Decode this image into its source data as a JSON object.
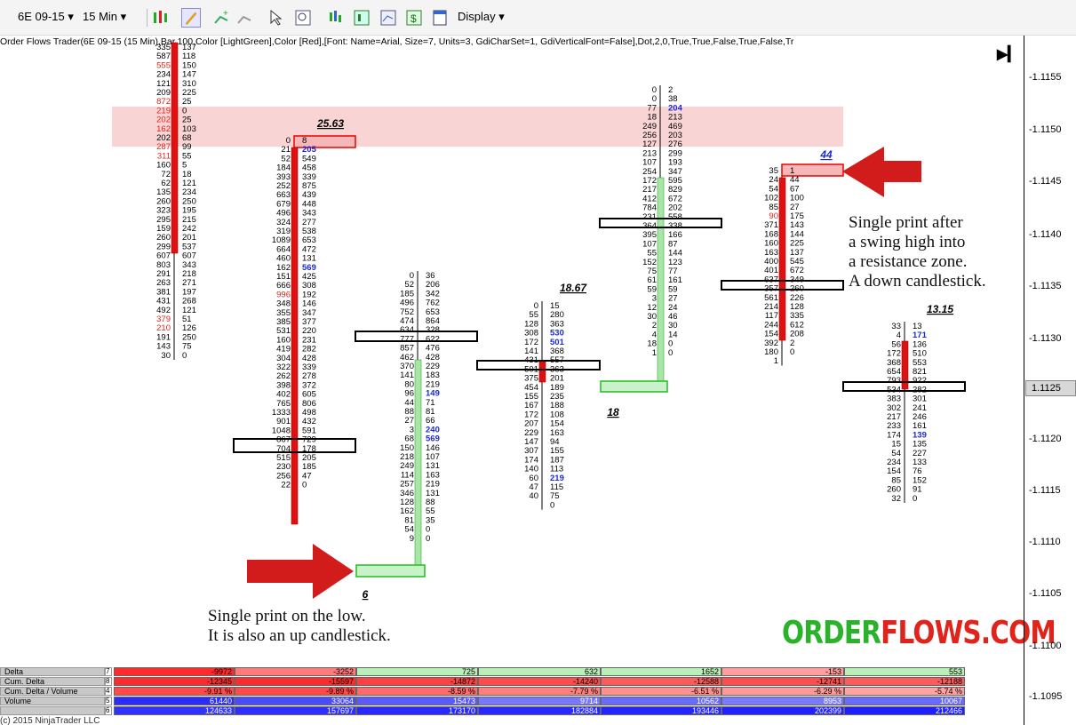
{
  "toolbar": {
    "instrument": "6E 09-15",
    "timeframe": "15 Min",
    "display_label": "Display"
  },
  "indicator_label": "Order Flows Trader(6E 09-15 (15 Min),Bar,100,Color [LightGreen],Color [Red],[Font: Name=Arial, Size=7, Units=3, GdiCharSet=1, GdiVerticalFont=False],Dot,2,0,True,True,False,True,False,Tr",
  "price_axis": {
    "ticks": [
      "1.1155",
      "1.1150",
      "1.1145",
      "1.1140",
      "1.1135",
      "1.1130",
      "1.1125",
      "1.1120",
      "1.1115",
      "1.1110",
      "1.1105",
      "1.1100",
      "1.1095"
    ],
    "current_price": "1.1125"
  },
  "annotations": {
    "low_note": "Single print on the low.\nIt is also an up candlestick.",
    "high_note": "Single print after\na swing high into\na resistance zone.\nA down candlestick."
  },
  "logo": {
    "part1": "ORDER",
    "part2": "FLOWS.COM"
  },
  "colors": {
    "bid_text": "#000000",
    "high_volume": "#e0241b",
    "imbalance": "#1a2ad8",
    "up_body": "#a8e6a8",
    "down_body": "#dd1111",
    "zone": "#f9d4d4"
  },
  "bar_labels": [
    "25.63",
    "6",
    "18.67",
    "18",
    "44",
    "13.15"
  ],
  "bars": [
    {
      "bid": [
        "335",
        "587",
        "555",
        "234",
        "121",
        "209",
        "872",
        "219",
        "202",
        "162",
        "202",
        "287",
        "311",
        "160",
        "72",
        "62",
        "135",
        "260",
        "323",
        "295",
        "159",
        "260",
        "299",
        "607",
        "803",
        "291",
        "263",
        "381",
        "431",
        "492",
        "379",
        "210",
        "191",
        "143",
        "30"
      ],
      "ask": [
        "137",
        "118",
        "150",
        "147",
        "310",
        "225",
        "25",
        "0",
        "25",
        "103",
        "68",
        "99",
        "55",
        "5",
        "18",
        "121",
        "234",
        "250",
        "195",
        "215",
        "242",
        "201",
        "537",
        "607",
        "343",
        "218",
        "271",
        "197",
        "268",
        "121",
        "51",
        "126",
        "250",
        "75",
        "0"
      ]
    },
    {
      "bid": [
        "0",
        "21",
        "52",
        "184",
        "393",
        "252",
        "663",
        "679",
        "496",
        "324",
        "319",
        "1089",
        "664",
        "460",
        "162",
        "151",
        "666",
        "996",
        "348",
        "355",
        "385",
        "531",
        "160",
        "419",
        "304",
        "322",
        "262",
        "398",
        "402",
        "765",
        "1333",
        "901",
        "1048",
        "867",
        "704",
        "515",
        "230",
        "256",
        "22"
      ],
      "ask": [
        "8",
        "205",
        "549",
        "458",
        "339",
        "875",
        "439",
        "448",
        "343",
        "277",
        "538",
        "653",
        "472",
        "131",
        "569",
        "425",
        "308",
        "192",
        "146",
        "347",
        "377",
        "220",
        "231",
        "282",
        "428",
        "339",
        "278",
        "372",
        "605",
        "806",
        "498",
        "432",
        "591",
        "729",
        "178",
        "205",
        "185",
        "47",
        "0"
      ]
    },
    {
      "bid": [
        "0",
        "52",
        "185",
        "496",
        "752",
        "474",
        "634",
        "777",
        "857",
        "462",
        "370",
        "141",
        "80",
        "96",
        "44",
        "88",
        "27",
        "3",
        "68",
        "150",
        "218",
        "249",
        "114",
        "257",
        "346",
        "128",
        "162",
        "81",
        "54",
        "9"
      ],
      "ask": [
        "36",
        "206",
        "342",
        "762",
        "653",
        "864",
        "328",
        "622",
        "476",
        "428",
        "229",
        "183",
        "219",
        "149",
        "71",
        "81",
        "66",
        "240",
        "569",
        "146",
        "107",
        "131",
        "163",
        "219",
        "131",
        "88",
        "55",
        "35",
        "0",
        "0"
      ]
    },
    {
      "bid": [
        "0",
        "55",
        "128",
        "308",
        "172",
        "141",
        "431",
        "501",
        "375",
        "454",
        "155",
        "167",
        "172",
        "207",
        "229",
        "147",
        "307",
        "174",
        "140",
        "60",
        "47",
        "40"
      ],
      "ask": [
        "15",
        "280",
        "363",
        "530",
        "501",
        "368",
        "557",
        "363",
        "201",
        "189",
        "235",
        "188",
        "108",
        "154",
        "163",
        "94",
        "155",
        "187",
        "113",
        "219",
        "115",
        "75",
        "0"
      ]
    },
    {
      "bid": [
        "0",
        "0",
        "77",
        "18",
        "249",
        "256",
        "127",
        "213",
        "107",
        "254",
        "172",
        "217",
        "412",
        "784",
        "231",
        "364",
        "395",
        "107",
        "55",
        "152",
        "75",
        "61",
        "59",
        "3",
        "12",
        "30",
        "2",
        "4",
        "18",
        "1"
      ],
      "ask": [
        "2",
        "38",
        "204",
        "213",
        "469",
        "203",
        "276",
        "299",
        "193",
        "347",
        "595",
        "829",
        "672",
        "202",
        "558",
        "338",
        "166",
        "87",
        "144",
        "123",
        "77",
        "161",
        "59",
        "27",
        "24",
        "46",
        "30",
        "14",
        "0",
        "0"
      ]
    },
    {
      "bid": [
        "35",
        "24",
        "54",
        "102",
        "85",
        "90",
        "371",
        "168",
        "160",
        "163",
        "400",
        "401",
        "637",
        "357",
        "561",
        "214",
        "117",
        "244",
        "154",
        "392",
        "180",
        "1"
      ],
      "ask": [
        "1",
        "44",
        "67",
        "100",
        "27",
        "175",
        "143",
        "144",
        "225",
        "137",
        "545",
        "672",
        "349",
        "260",
        "226",
        "128",
        "335",
        "612",
        "208",
        "2",
        "0"
      ]
    },
    {
      "bid": [
        "33",
        "4",
        "56",
        "172",
        "368",
        "654",
        "793",
        "534",
        "383",
        "302",
        "217",
        "233",
        "174",
        "15",
        "54",
        "234",
        "154",
        "85",
        "260",
        "32"
      ],
      "ask": [
        "13",
        "171",
        "136",
        "510",
        "553",
        "821",
        "922",
        "282",
        "301",
        "241",
        "246",
        "161",
        "139",
        "135",
        "227",
        "133",
        "76",
        "152",
        "91",
        "0"
      ]
    }
  ],
  "stats_table": {
    "rows": [
      {
        "label": "Delta",
        "num": "7",
        "values": [
          "-9972",
          "-3252",
          "725",
          "632",
          "1652",
          "-153",
          "553"
        ]
      },
      {
        "label": "Cum. Delta",
        "num": "8",
        "values": [
          "-12345",
          "-15597",
          "-14872",
          "-14240",
          "-12588",
          "-12741",
          "-12188"
        ]
      },
      {
        "label": "Cum. Delta / Volume",
        "num": "4",
        "values": [
          "-9.91 %",
          "-9.89 %",
          "-8.59 %",
          "-7.79 %",
          "-6.51 %",
          "-6.29 %",
          "-5.74 %"
        ]
      },
      {
        "label": "Volume",
        "num": "5",
        "values": [
          "61440",
          "33064",
          "15473",
          "9714",
          "10562",
          "8953",
          "10067"
        ]
      },
      {
        "label": "",
        "num": "6",
        "values": [
          "124633",
          "157697",
          "173170",
          "182884",
          "193446",
          "202399",
          "212466"
        ]
      }
    ],
    "copyright": "(c) 2015 NinjaTrader LLC"
  }
}
